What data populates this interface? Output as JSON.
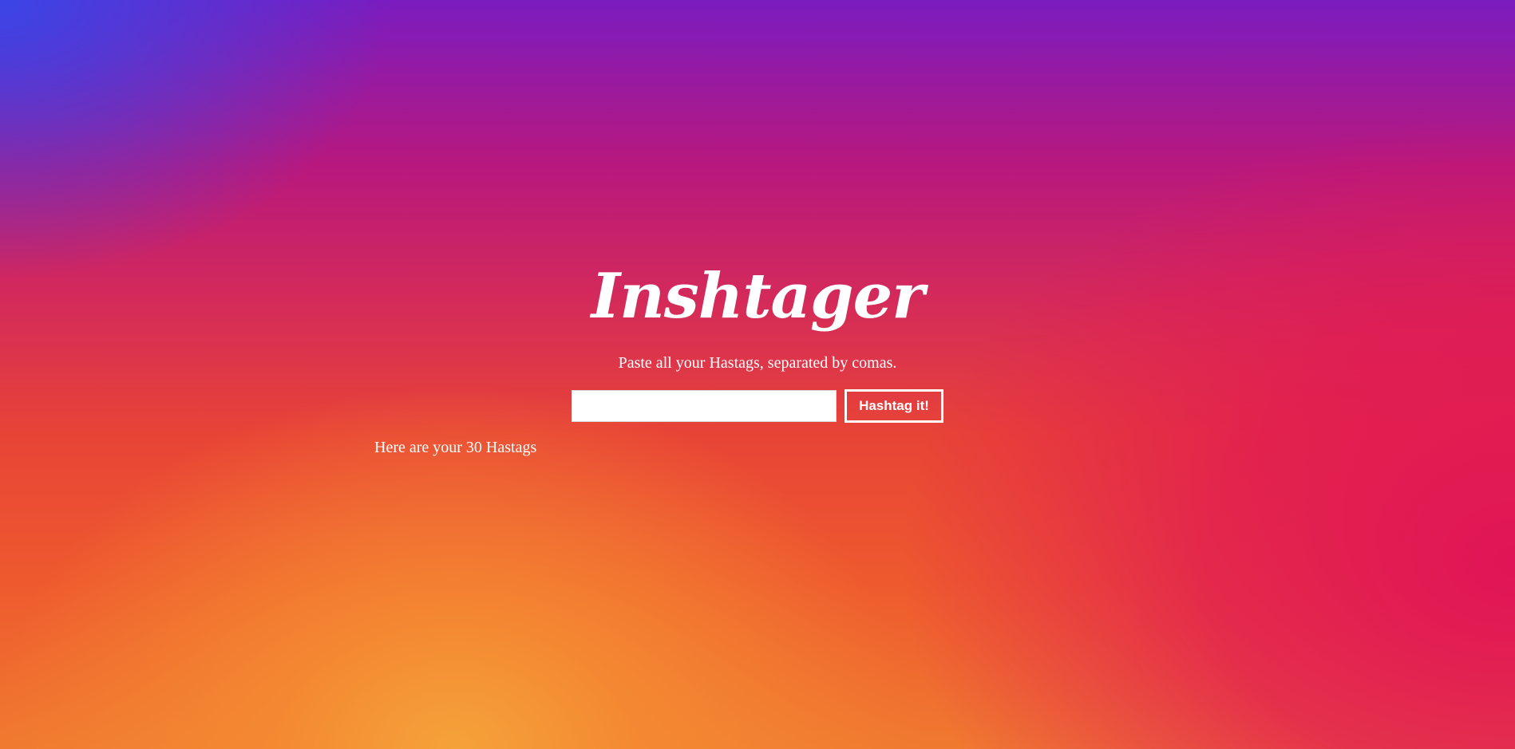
{
  "app": {
    "title": "Inshtager",
    "subtitle": "Paste all your Hastags, separated by comas."
  },
  "form": {
    "input_value": "",
    "input_placeholder": "",
    "button_label": "Hashtag it!"
  },
  "result": {
    "label": "Here are your 30 Hastags"
  },
  "colors": {
    "text": "#ffffff",
    "gradient_top": "#7a1cc0",
    "gradient_middle": "#e84436",
    "gradient_bottom": "#f5a23a",
    "gradient_right": "#e01457"
  }
}
